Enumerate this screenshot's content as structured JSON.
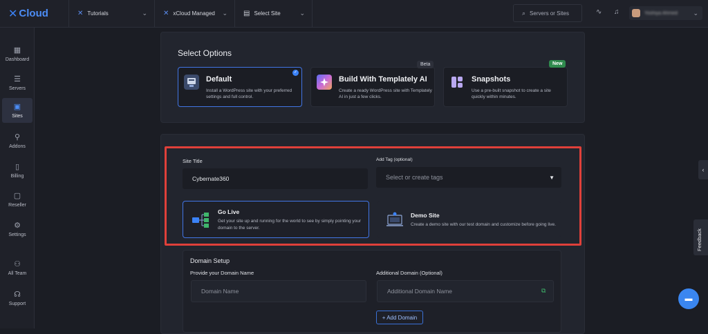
{
  "brand": {
    "logo_mark": "✕",
    "name": "Cloud"
  },
  "topbar": {
    "tutorials": "Tutorials",
    "provider": "xCloud Managed",
    "site": "Select Site",
    "search_placeholder": "Servers or Sites",
    "user_name": "Yoshiya Ahmed"
  },
  "sidebar": {
    "items": [
      {
        "label": "Dashboard",
        "icon": "dashboard-icon",
        "glyph": "▦"
      },
      {
        "label": "Servers",
        "icon": "servers-icon",
        "glyph": "☰"
      },
      {
        "label": "Sites",
        "icon": "sites-icon",
        "glyph": "▣"
      },
      {
        "label": "Addons",
        "icon": "addons-icon",
        "glyph": "⚲"
      },
      {
        "label": "Billing",
        "icon": "billing-icon",
        "glyph": "▯"
      },
      {
        "label": "Reseller",
        "icon": "reseller-icon",
        "glyph": "▢"
      },
      {
        "label": "Settings",
        "icon": "settings-icon",
        "glyph": "⚙"
      },
      {
        "label": "All Team",
        "icon": "team-icon",
        "glyph": "⚇"
      },
      {
        "label": "Support",
        "icon": "support-icon",
        "glyph": "☊"
      }
    ]
  },
  "select_options": {
    "title": "Select Options",
    "options": [
      {
        "title": "Default",
        "desc": "Install a WordPress site with your preferred settings and full control."
      },
      {
        "title": "Build With Templately AI",
        "desc": "Create a ready WordPress site with Templately AI in just a few clicks.",
        "badge": "Beta"
      },
      {
        "title": "Snapshots",
        "desc": "Use a pre-built snapshot to create a site quickly within minutes.",
        "badge": "New"
      }
    ]
  },
  "form": {
    "site_title_label": "Site Title",
    "site_title_value": "Cybernate360",
    "tag_label": "Add Tag (optional)",
    "tag_placeholder": "Select or create tags",
    "go_live": {
      "title": "Go Live",
      "desc": "Get your site up and running for the world to see by simply pointing your domain to the server."
    },
    "demo_site": {
      "title": "Demo Site",
      "desc": "Create a demo site with our test domain and customize before going live."
    }
  },
  "domain": {
    "section_title": "Domain Setup",
    "domain_label": "Provide your Domain Name",
    "domain_placeholder": "Domain Name",
    "additional_label": "Additional Domain (Optional)",
    "additional_placeholder": "Additional Domain Name",
    "add_button": "+ Add Domain"
  },
  "feedback_label": "Feedback",
  "colors": {
    "accent": "#3b82f6",
    "highlight": "#e0403a",
    "new_badge": "#2f8a4d"
  }
}
